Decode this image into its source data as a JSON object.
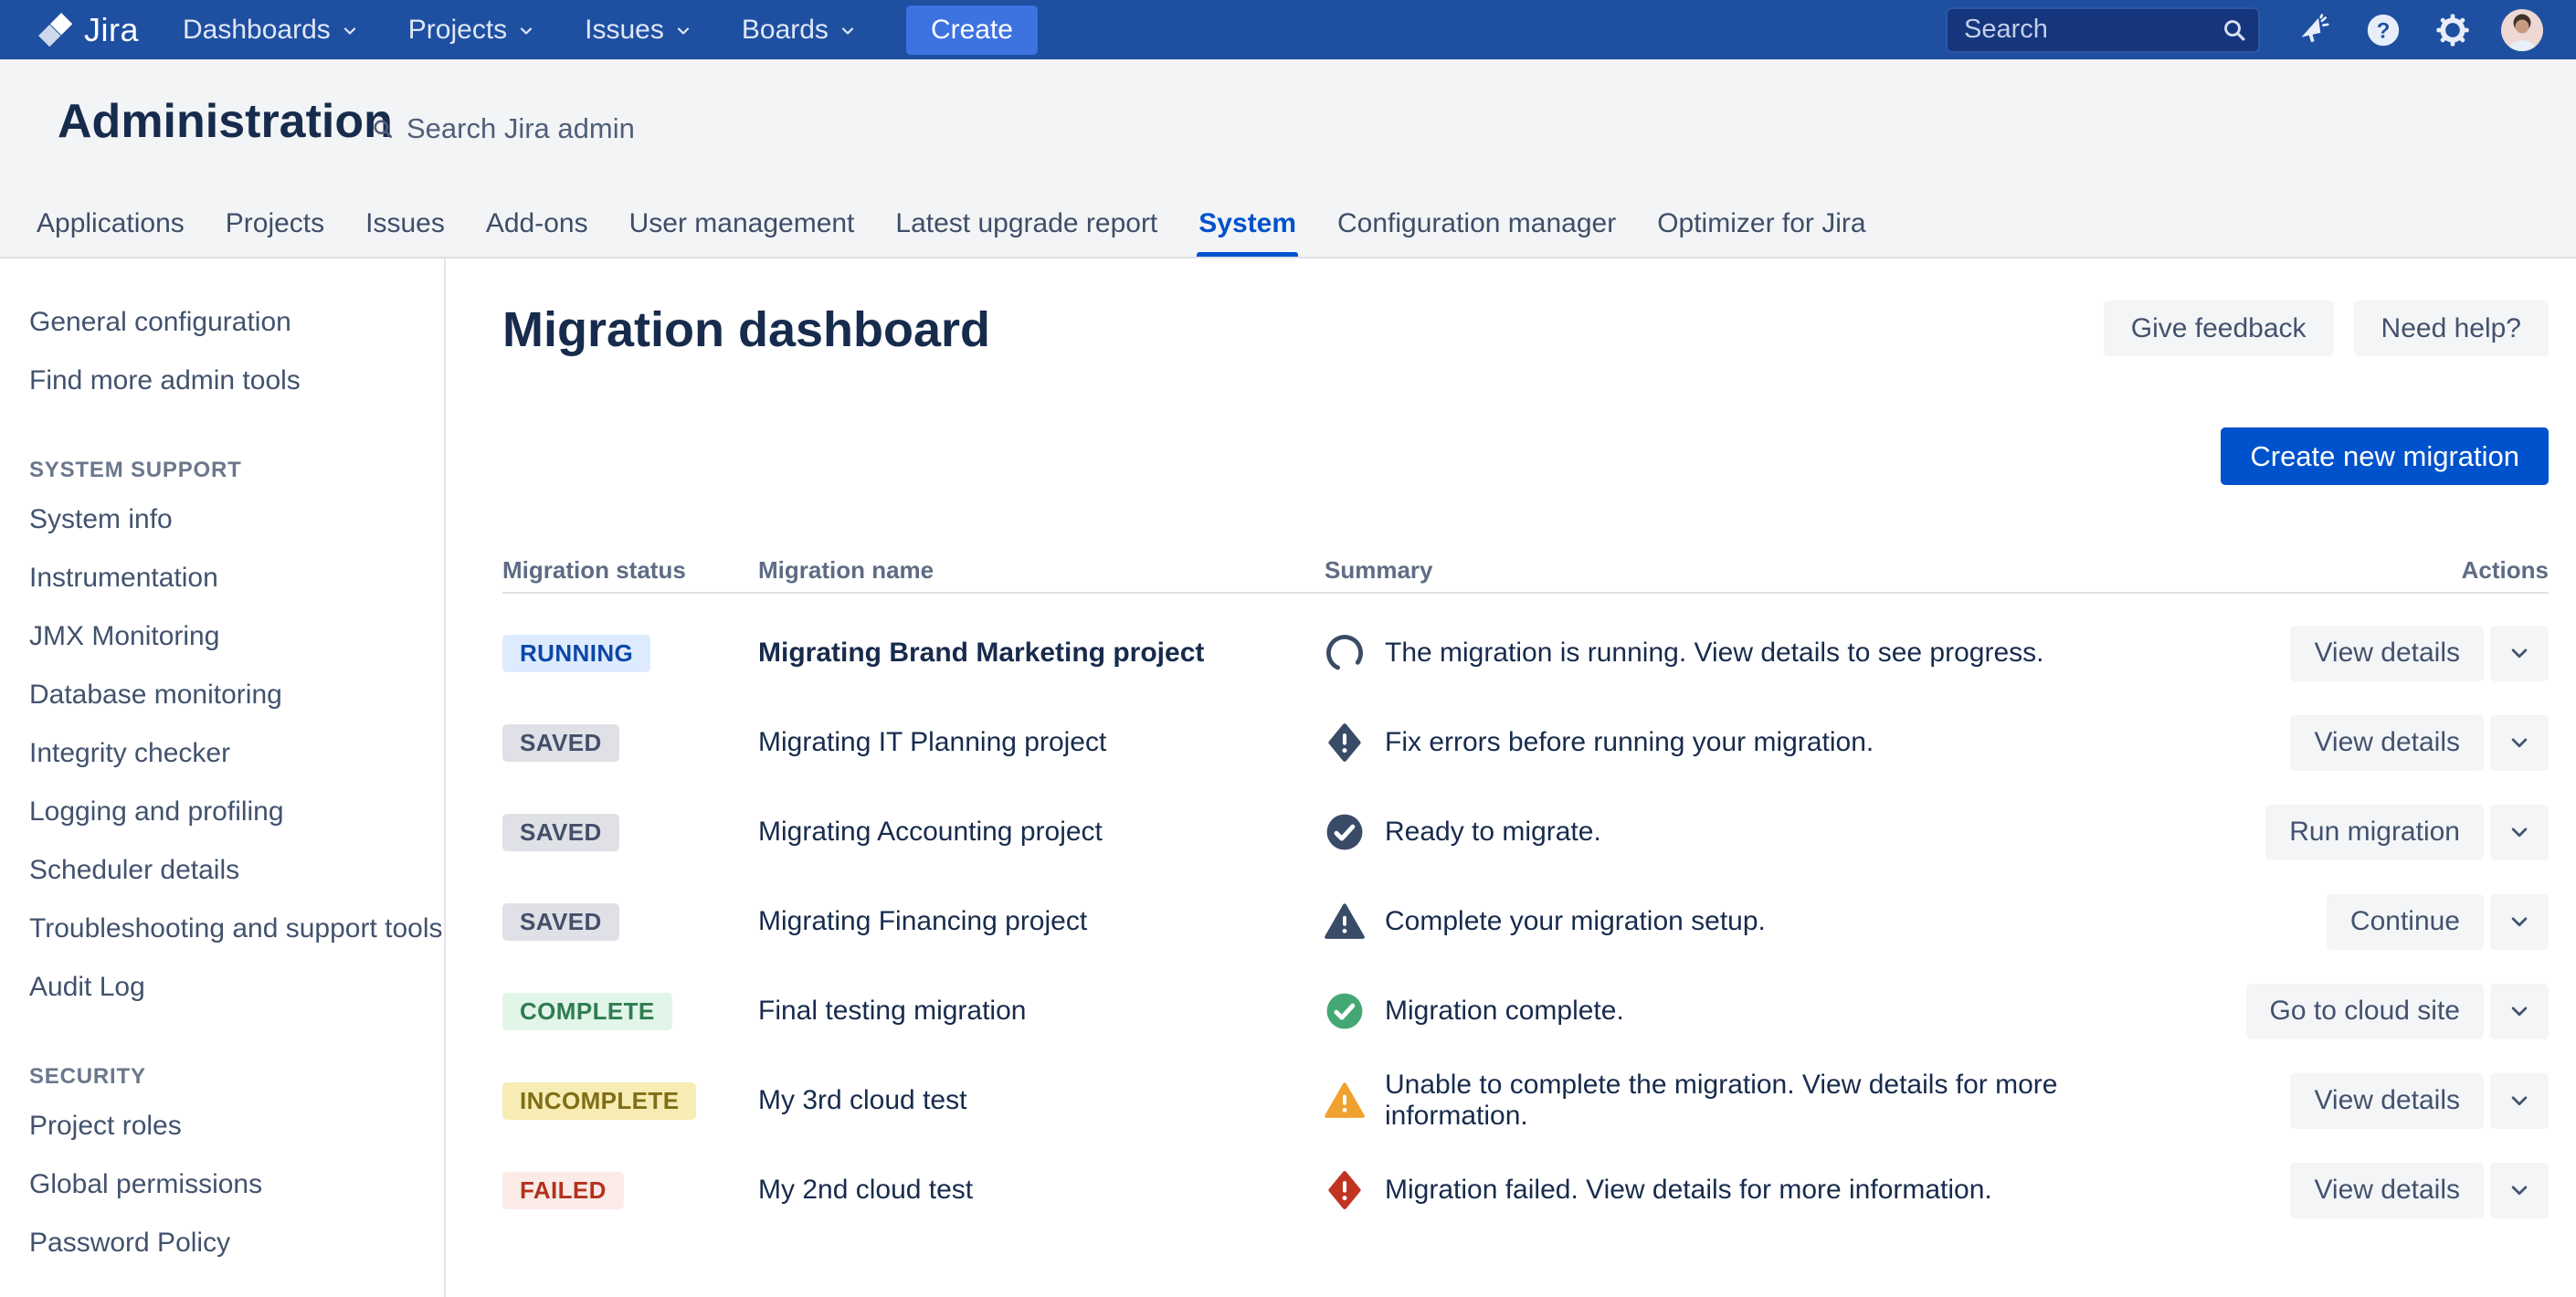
{
  "topnav": {
    "brand": "Jira",
    "menu": [
      "Dashboards",
      "Projects",
      "Issues",
      "Boards"
    ],
    "create_label": "Create",
    "search_placeholder": "Search",
    "icons": [
      "announcement-icon",
      "help-icon",
      "settings-icon",
      "user-avatar"
    ]
  },
  "admin_header": {
    "title": "Administration",
    "search_label": "Search Jira admin"
  },
  "tabs": [
    {
      "label": "Applications",
      "active": false
    },
    {
      "label": "Projects",
      "active": false
    },
    {
      "label": "Issues",
      "active": false
    },
    {
      "label": "Add-ons",
      "active": false
    },
    {
      "label": "User management",
      "active": false
    },
    {
      "label": "Latest upgrade report",
      "active": false
    },
    {
      "label": "System",
      "active": true
    },
    {
      "label": "Configuration manager",
      "active": false
    },
    {
      "label": "Optimizer for Jira",
      "active": false
    }
  ],
  "sidebar": {
    "groups": [
      {
        "title": "",
        "items": [
          "General configuration",
          "Find more admin tools"
        ]
      },
      {
        "title": "SYSTEM SUPPORT",
        "items": [
          "System info",
          "Instrumentation",
          "JMX Monitoring",
          "Database monitoring",
          "Integrity checker",
          "Logging and profiling",
          "Scheduler details",
          "Troubleshooting and support tools",
          "Audit Log"
        ]
      },
      {
        "title": "SECURITY",
        "items": [
          "Project roles",
          "Global permissions",
          "Password Policy"
        ]
      }
    ]
  },
  "main": {
    "title": "Migration dashboard",
    "feedback_label": "Give feedback",
    "help_label": "Need help?",
    "create_migration_label": "Create new migration",
    "table": {
      "columns": [
        "Migration status",
        "Migration name",
        "Summary",
        "Actions"
      ],
      "rows": [
        {
          "status": "RUNNING",
          "status_type": "running",
          "name": "Migrating Brand Marketing project",
          "name_bold": true,
          "icon": "spinner",
          "summary": "The migration is running. View details to see progress.",
          "action": "View details"
        },
        {
          "status": "SAVED",
          "status_type": "saved",
          "name": "Migrating IT Planning project",
          "name_bold": false,
          "icon": "error-diamond-dark",
          "summary": "Fix errors before running your migration.",
          "action": "View details"
        },
        {
          "status": "SAVED",
          "status_type": "saved",
          "name": "Migrating Accounting project",
          "name_bold": false,
          "icon": "check-circle-dark",
          "summary": "Ready to migrate.",
          "action": "Run migration"
        },
        {
          "status": "SAVED",
          "status_type": "saved",
          "name": "Migrating Financing project",
          "name_bold": false,
          "icon": "warning-triangle-dark",
          "summary": "Complete your migration setup.",
          "action": "Continue"
        },
        {
          "status": "COMPLETE",
          "status_type": "complete",
          "name": "Final testing migration",
          "name_bold": false,
          "icon": "check-circle-green",
          "summary": "Migration complete.",
          "action": "Go to cloud site"
        },
        {
          "status": "INCOMPLETE",
          "status_type": "incomplete",
          "name": "My 3rd cloud test",
          "name_bold": false,
          "icon": "warning-triangle-yellow",
          "summary": "Unable to complete the migration. View details for more information.",
          "action": "View details"
        },
        {
          "status": "FAILED",
          "status_type": "failed",
          "name": "My 2nd cloud test",
          "name_bold": false,
          "icon": "error-diamond-red",
          "summary": "Migration failed. View details for more information.",
          "action": "View details"
        }
      ]
    }
  },
  "colors": {
    "nav_bg": "#1E4FA1",
    "create_button": "#3D73E0",
    "primary_blue": "#0052CC",
    "header_bg": "#F3F4F6",
    "border": "#DFE1E6",
    "text_dark": "#172B4D",
    "text_muted": "#5E6C84",
    "sidebar_text": "#42526E",
    "badge_running_bg": "#DEEBFF",
    "badge_running_text": "#0B47A6",
    "badge_saved_bg": "#DFE1E6",
    "badge_saved_text": "#44506B",
    "badge_complete_bg": "#E2F5E9",
    "badge_complete_text": "#2F7D51",
    "badge_incomplete_bg": "#F7ECB4",
    "badge_incomplete_text": "#7F6E14",
    "badge_failed_bg": "#FBEBE7",
    "badge_failed_text": "#B3311D",
    "icon_dark": "#394B67",
    "icon_green": "#44A874",
    "icon_yellow": "#F0A12F",
    "icon_red": "#C03522"
  }
}
